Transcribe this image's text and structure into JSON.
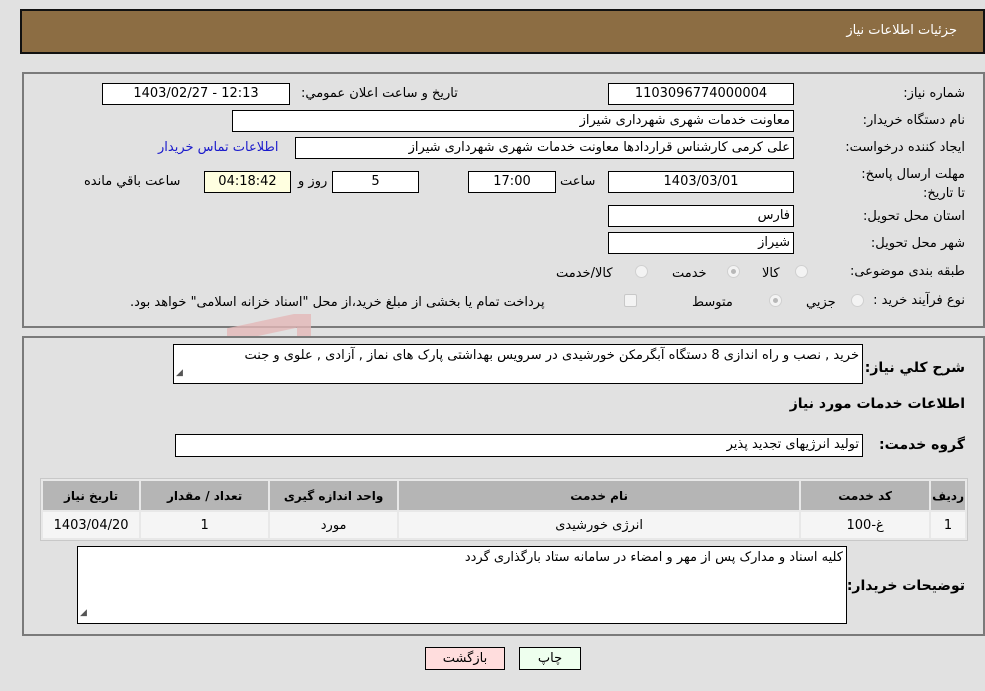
{
  "header": {
    "title": "جزئیات اطلاعات نیاز"
  },
  "form": {
    "need_number": {
      "label": "شماره نیاز:",
      "value": "1103096774000004"
    },
    "announce_datetime": {
      "label": "تاریخ و ساعت اعلان عمومي:",
      "value": "1403/02/27 - 12:13"
    },
    "buyer_org": {
      "label": "نام دستگاه خریدار:",
      "value": "معاونت خدمات شهری شهرداری شیراز"
    },
    "requester": {
      "label": "ایجاد کننده درخواست:",
      "value": "علی کرمی کارشناس قراردادها معاونت خدمات شهری شهرداری شیراز"
    },
    "buyer_contact_link": "اطلاعات تماس خریدار",
    "deadline": {
      "label": "مهلت ارسال پاسخ: تا تاریخ:",
      "date": "1403/03/01",
      "time_label": "ساعت",
      "time": "17:00",
      "days": "5",
      "days_label": "روز و",
      "remaining": "04:18:42",
      "remaining_label": "ساعت باقي مانده"
    },
    "province": {
      "label": "استان محل تحویل:",
      "value": "فارس"
    },
    "city": {
      "label": "شهر محل تحویل:",
      "value": "شیراز"
    },
    "category": {
      "label": "طبقه بندی موضوعی:",
      "options": [
        "کالا",
        "خدمت",
        "کالا/خدمت"
      ],
      "selected": "خدمت"
    },
    "process_type": {
      "label": "نوع فرآیند خرید :",
      "options": [
        "جزيي",
        "متوسط"
      ],
      "selected": "متوسط",
      "treasury_note": "پرداخت تمام یا بخشی از مبلغ خرید،از محل \"اسناد خزانه اسلامی\" خواهد بود."
    }
  },
  "details": {
    "description_label": "شرح کلي نياز:",
    "description": "خرید , نصب و راه اندازی 8 دستگاه آبگرمکن خورشیدی در سرویس بهداشتی پارک های نماز , آزادی , علوی و جنت",
    "services_heading": "اطلاعات خدمات مورد نیاز",
    "service_group_label": "گروه خدمت:",
    "service_group": "تولید انرژیهای تجدید پذیر",
    "table": {
      "headers": [
        "ردیف",
        "کد خدمت",
        "نام خدمت",
        "واحد اندازه گیری",
        "تعداد / مقدار",
        "تاریخ نیاز"
      ],
      "rows": [
        [
          "1",
          "غ-100",
          "انرژی خورشیدی",
          "مورد",
          "1",
          "1403/04/20"
        ]
      ]
    },
    "buyer_notes_label": "توضیحات خریدار:",
    "buyer_notes": "کلیه اسناد و مدارک پس از مهر و امضاء در سامانه ستاد بارگذاری گردد"
  },
  "buttons": {
    "print": "چاپ",
    "back": "بازگشت"
  },
  "colors": {
    "header_bg": "#8c6d43",
    "print_bg": "#eeffee",
    "back_bg": "#ffdddd",
    "link": "#1a1acc"
  }
}
